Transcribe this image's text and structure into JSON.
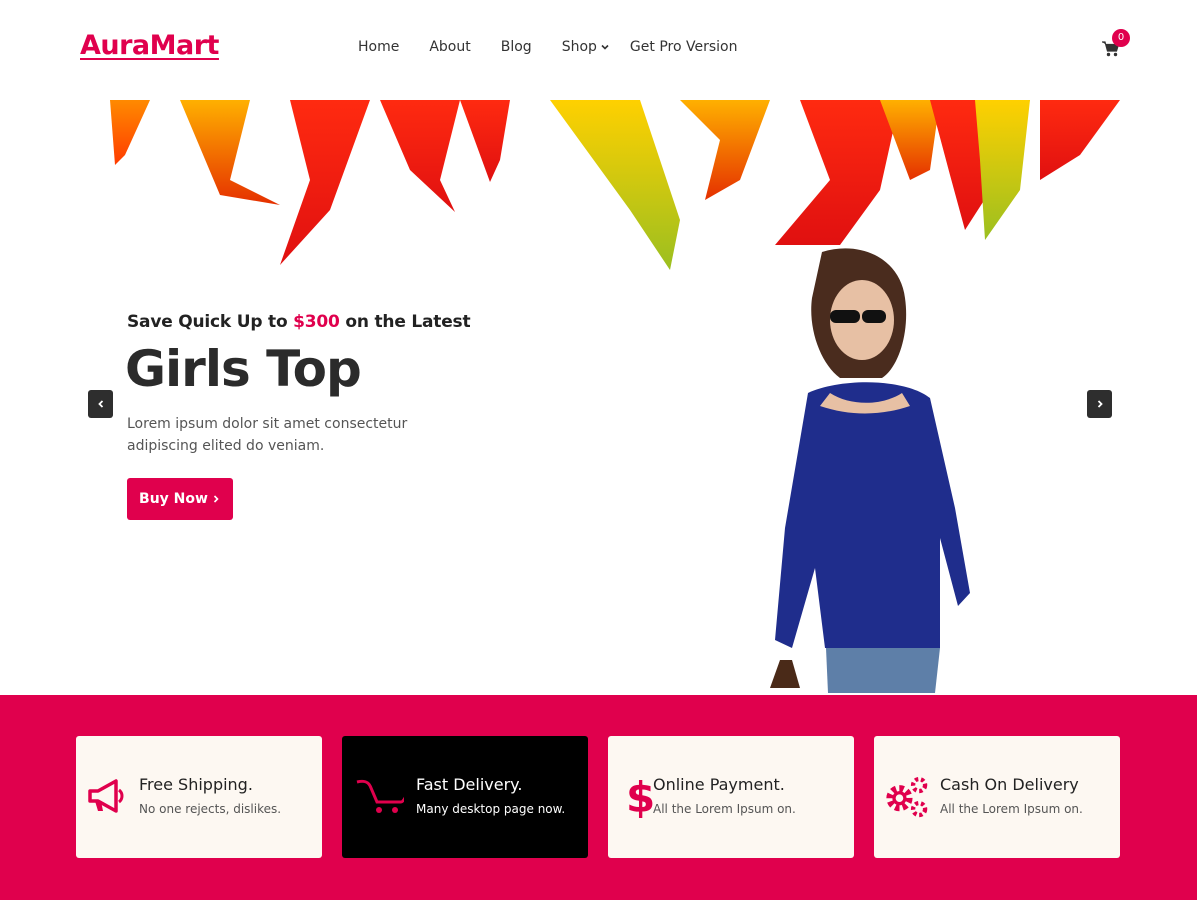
{
  "header": {
    "logo": "AuraMart",
    "nav": [
      {
        "label": "Home"
      },
      {
        "label": "About"
      },
      {
        "label": "Blog"
      },
      {
        "label": "Shop"
      },
      {
        "label": "Get Pro Version"
      }
    ],
    "cart_count": "0",
    "cart_icon": "shopping-cart-icon"
  },
  "hero": {
    "eyebrow_prefix": "Save Quick Up to ",
    "eyebrow_amount": "$300",
    "eyebrow_suffix": " on the Latest",
    "title": "Girls Top",
    "desc_line1": "Lorem ipsum dolor sit amet consectetur",
    "desc_line2": "adipiscing elited do veniam.",
    "button_label": "Buy Now",
    "button_icon": "chevron-right-icon",
    "prev_icon": "chevron-left-icon",
    "next_icon": "chevron-right-icon"
  },
  "features": [
    {
      "title": "Free Shipping.",
      "subtitle": "No one rejects, dislikes.",
      "icon": "megaphone-icon"
    },
    {
      "title": "Fast Delivery.",
      "subtitle": "Many desktop page now.",
      "icon": "cart-icon"
    },
    {
      "title": "Online Payment.",
      "subtitle": "All the Lorem Ipsum on.",
      "icon": "dollar-icon"
    },
    {
      "title": "Cash On Delivery",
      "subtitle": "All the Lorem Ipsum on.",
      "icon": "gears-icon"
    }
  ],
  "colors": {
    "accent": "#e0004d",
    "dark": "#000000",
    "card_bg": "#fdf8f2"
  }
}
